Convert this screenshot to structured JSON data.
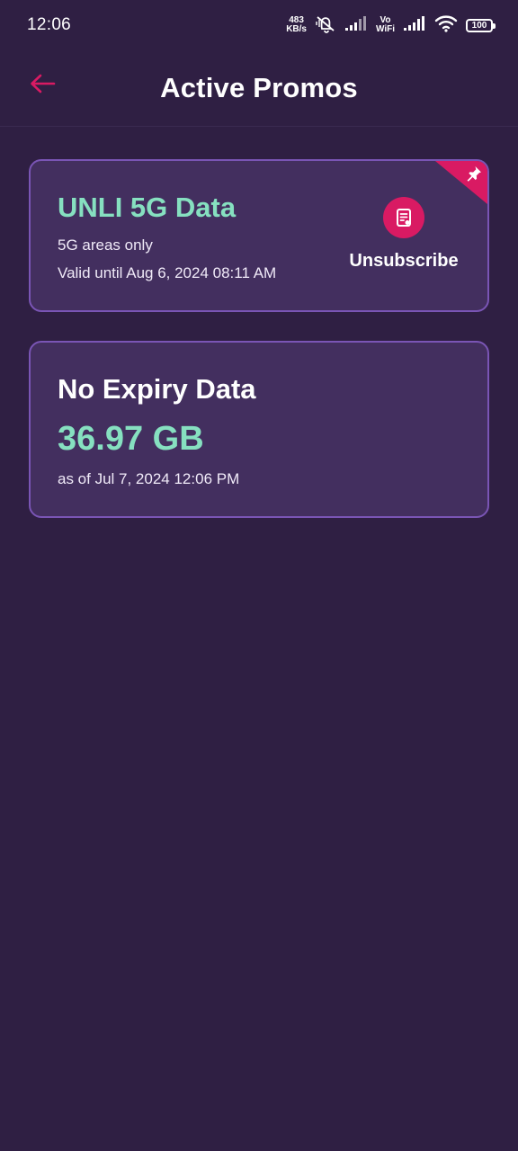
{
  "status_bar": {
    "time": "12:06",
    "net_speed_value": "483",
    "net_speed_unit": "KB/s",
    "vo_label": "Vo",
    "wifi_label": "WiFi",
    "battery": "100"
  },
  "header": {
    "title": "Active Promos",
    "back_icon": "arrow-left-icon"
  },
  "promos": [
    {
      "name": "UNLI 5G Data",
      "note": "5G areas only",
      "validity": "Valid until Aug 6, 2024 08:11 AM",
      "action_label": "Unsubscribe",
      "action_icon": "document-icon",
      "pinned": true
    }
  ],
  "data_balance": {
    "title": "No Expiry Data",
    "amount": "36.97 GB",
    "as_of": "as of Jul 7, 2024 12:06 PM"
  },
  "colors": {
    "background": "#2f1f43",
    "card": "#432f5f",
    "card_border": "#7a55b5",
    "accent_green": "#86e0c0",
    "accent_pink": "#d91a63"
  }
}
